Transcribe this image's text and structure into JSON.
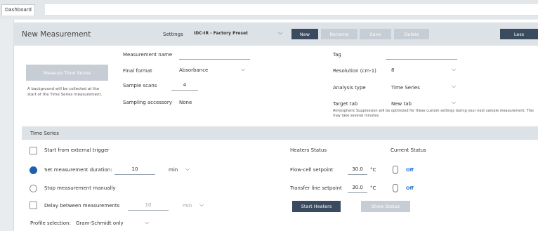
{
  "tab": {
    "label": "Dashboard"
  },
  "header": {
    "title": "New Measurement",
    "settings_label": "Settings",
    "settings_value": "IDC-IR - Factory Preset",
    "new_label": "New",
    "rename_label": "Rename",
    "save_label": "Save",
    "delete_label": "Delete",
    "less_label": "Less"
  },
  "left": {
    "measure_button": "Measure Time Series",
    "background_note": "A background will be collected at the start of the Time Series measurement."
  },
  "form": {
    "measurement_name_label": "Measurement name",
    "measurement_name_value": "",
    "final_format_label": "Final format",
    "final_format_value": "Absorbance",
    "sample_scans_label": "Sample scans",
    "sample_scans_value": "4",
    "sampling_accessory_label": "Sampling accessory",
    "sampling_accessory_value": "None",
    "tag_label": "Tag",
    "tag_value": "",
    "resolution_label": "Resolution (cm-1)",
    "resolution_value": "8",
    "analysis_type_label": "Analysis type",
    "analysis_type_value": "Time Series",
    "target_tab_label": "Target tab",
    "target_tab_value": "New tab",
    "suppression_note": "Atmospheric Suppression will be optimized for these custom settings during your next sample measurement. This may take several minutes."
  },
  "time_series": {
    "section_title": "Time Series",
    "external_trigger_label": "Start from external trigger",
    "duration_label": "Set measurement duration:",
    "duration_value": "10",
    "duration_unit": "min",
    "stop_manually_label": "Stop measurement manually",
    "delay_label": "Delay between measurements",
    "delay_value": "10",
    "delay_unit": "min",
    "profile_label": "Profile selection:",
    "profile_value": "Gram-Schmidt only"
  },
  "heaters": {
    "status_title": "Heaters Status",
    "current_status_title": "Current Status",
    "flow_cell_label": "Flow-cell setpoint",
    "flow_cell_value": "30.0",
    "flow_cell_unit": "°C",
    "flow_cell_status": "Off",
    "transfer_line_label": "Transfer line setpoint",
    "transfer_line_value": "30.0",
    "transfer_line_unit": "°C",
    "transfer_line_status": "Off",
    "start_heaters_label": "Start Heaters",
    "show_status_label": "Show Status"
  },
  "colors": {
    "accent_dark": "#3a4a5f",
    "disabled": "#c7cdd4",
    "header_bg": "#dde2e7",
    "off_blue": "#1f6fd6",
    "radio_on": "#1f5fae"
  }
}
